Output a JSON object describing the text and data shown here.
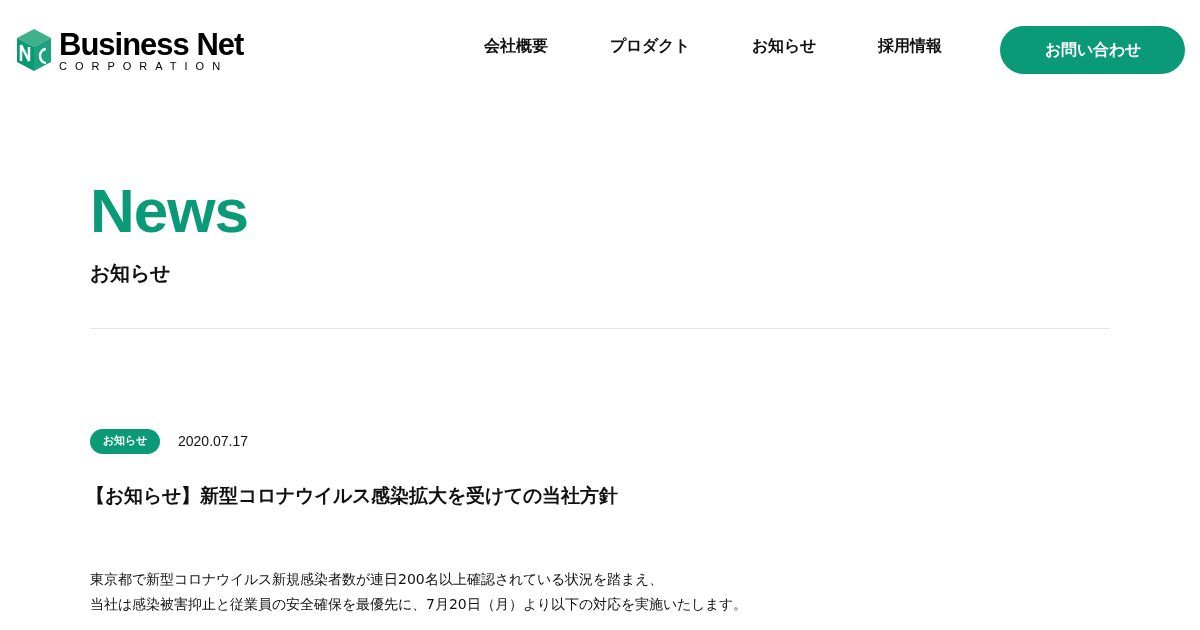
{
  "header": {
    "logo": {
      "name": "Business Net",
      "subtitle": "CORPORATION"
    },
    "nav": [
      {
        "label": "会社概要"
      },
      {
        "label": "プロダクト"
      },
      {
        "label": "お知らせ"
      },
      {
        "label": "採用情報"
      }
    ],
    "cta": "お問い合わせ"
  },
  "hero": {
    "title": "News",
    "subtitle": "お知らせ"
  },
  "article": {
    "category": "お知らせ",
    "date": "2020.07.17",
    "title": "【お知らせ】新型コロナウイルス感染拡大を受けての当社方針",
    "body": [
      "東京都で新型コロナウイルス新規感染者数が連日200名以上確認されている状況を踏まえ、",
      "当社は感染被害抑止と従業員の安全確保を最優先に、7月20日（月）より以下の対応を実施いたします。"
    ]
  }
}
